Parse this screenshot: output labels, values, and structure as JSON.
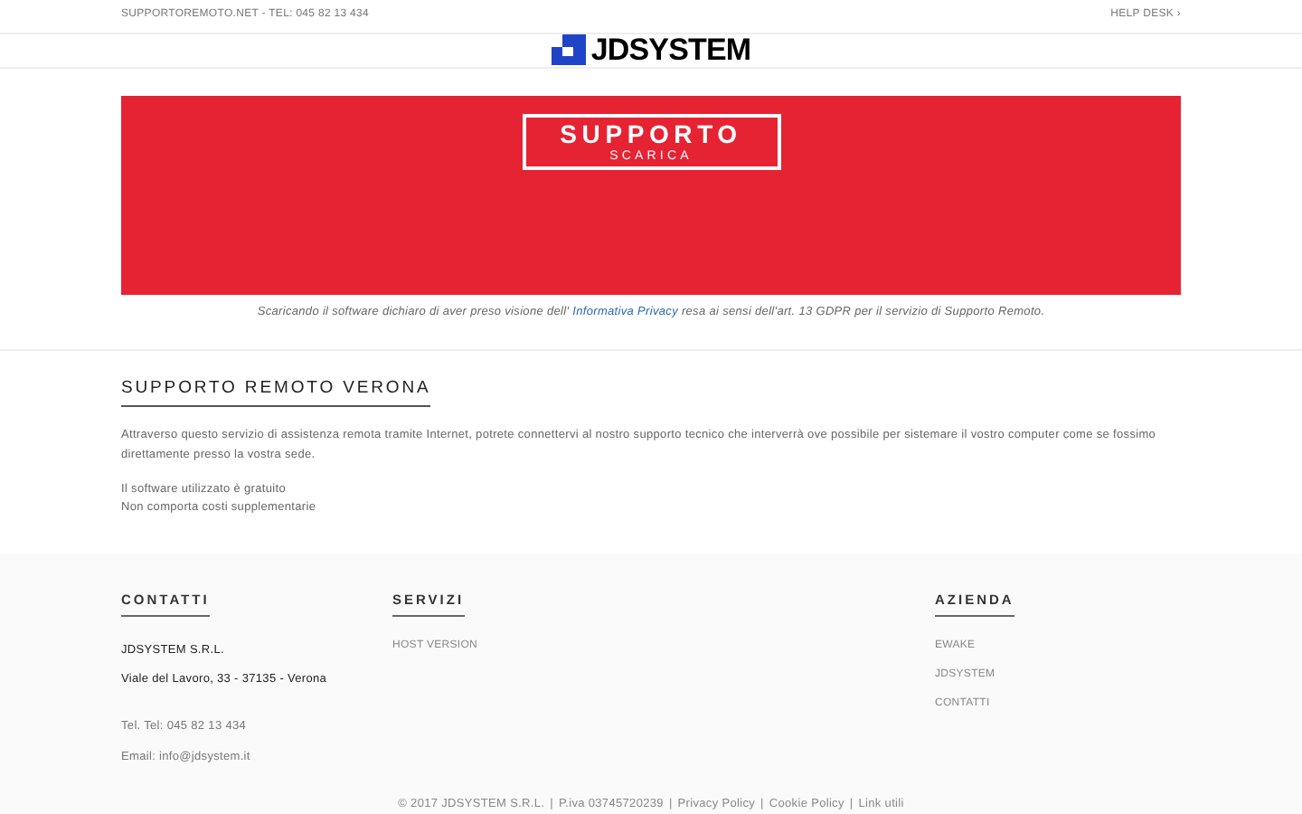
{
  "top_bar": {
    "contact": "SUPPORTOREMOTO.NET - TEL: 045 82 13 434",
    "help_link": "HELP DESK ›"
  },
  "logo": {
    "text": "JDSYSTEM"
  },
  "hero": {
    "title": "SUPPORTO",
    "subtitle": "SCARICA"
  },
  "disclaimer": {
    "before": "Scaricando il software dichiaro di aver preso visione dell'",
    "link": "Informativa Privacy",
    "after": "resa ai sensi dell'art. 13 GDPR per il servizio di Supporto Remoto."
  },
  "section": {
    "title": "SUPPORTO REMOTO VERONA",
    "paragraph": "Attraverso questo servizio di assistenza remota tramite Internet, potrete connettervi al nostro supporto tecnico che interverrà ove possibile per sistemare il vostro computer come se fossimo direttamente presso la vostra sede.",
    "notes": [
      "Il software utilizzato è gratuito",
      "Non comporta costi supplementarie"
    ]
  },
  "footer": {
    "contatti": {
      "title": "CONTATTI",
      "company": "JDSYSTEM S.R.L.",
      "address": "Viale del Lavoro, 33 - 37135 - Verona",
      "phone": "Tel. Tel: 045 82 13 434",
      "email": "Email: info@jdsystem.it"
    },
    "servizi": {
      "title": "SERVIZI",
      "links": [
        "HOST VERSION"
      ]
    },
    "azienda": {
      "title": "AZIENDA",
      "links": [
        "EWAKE",
        "JDSYSTEM",
        "CONTATTI"
      ]
    },
    "copyright": "© 2017 JDSYSTEM S.R.L.",
    "separator": "|",
    "vat": "P.iva 03745720239",
    "links": [
      "Privacy Policy",
      "Cookie Policy",
      "Link utili"
    ]
  }
}
